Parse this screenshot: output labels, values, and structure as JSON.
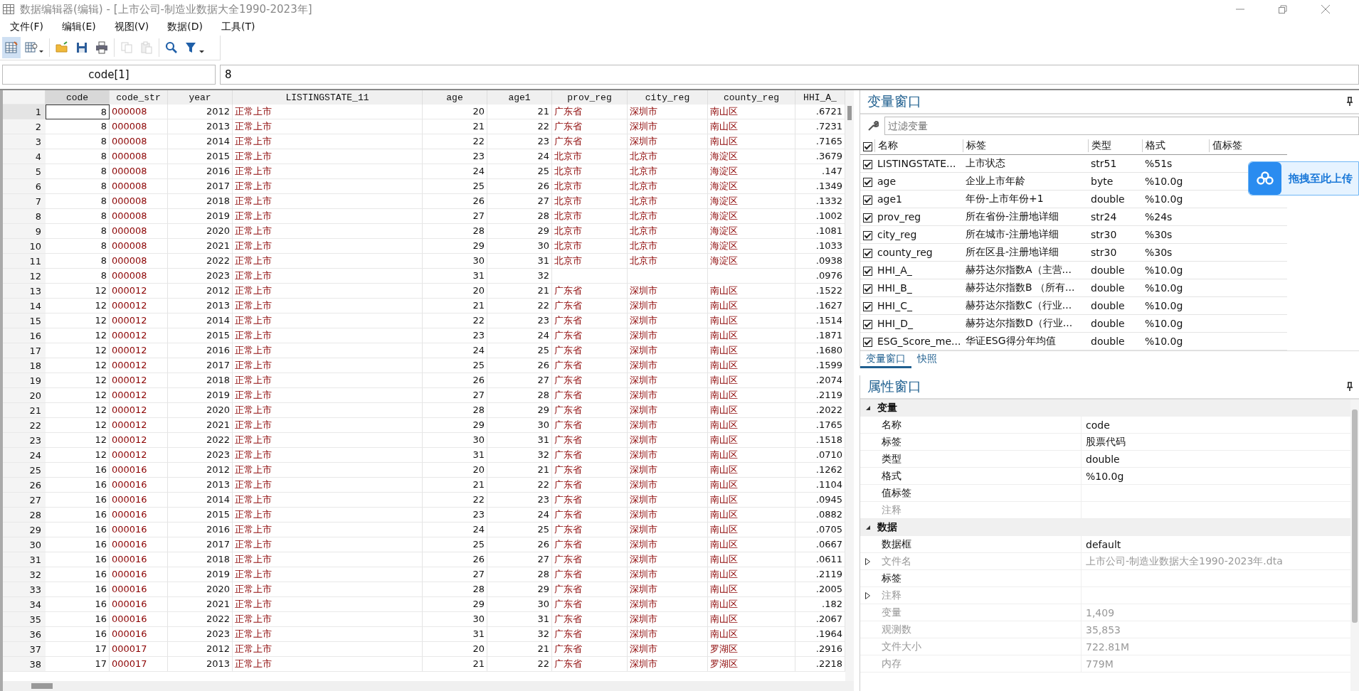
{
  "window": {
    "title": "数据编辑器(编辑) - [上市公司-制造业数据大全1990-2023年]"
  },
  "menu": [
    "文件(F)",
    "编辑(E)",
    "视图(V)",
    "数据(D)",
    "工具(T)"
  ],
  "toolbar": [
    {
      "kind": "grid-edit",
      "selected": true,
      "disabled": false
    },
    {
      "kind": "grid-browse",
      "selected": false,
      "disabled": false
    },
    {
      "kind": "folder",
      "selected": false,
      "disabled": false
    },
    {
      "kind": "save",
      "selected": false,
      "disabled": false
    },
    {
      "kind": "print",
      "selected": false,
      "disabled": false
    },
    {
      "kind": "copy",
      "selected": false,
      "disabled": true
    },
    {
      "kind": "paste",
      "selected": false,
      "disabled": true
    },
    {
      "kind": "search",
      "selected": false,
      "disabled": false
    },
    {
      "kind": "filter",
      "selected": false,
      "disabled": false
    }
  ],
  "cell_bar": {
    "name": "code[1]",
    "value": "8"
  },
  "table": {
    "columns": [
      {
        "label": "code",
        "kind": "num",
        "selected": true
      },
      {
        "label": "code_str",
        "kind": "str",
        "selected": false
      },
      {
        "label": "year",
        "kind": "num",
        "selected": false
      },
      {
        "label": "LISTINGSTATE_11",
        "kind": "str",
        "selected": false
      },
      {
        "label": "age",
        "kind": "num",
        "selected": false
      },
      {
        "label": "age1",
        "kind": "num",
        "selected": false
      },
      {
        "label": "prov_reg",
        "kind": "str",
        "selected": false
      },
      {
        "label": "city_reg",
        "kind": "str",
        "selected": false
      },
      {
        "label": "county_reg",
        "kind": "str",
        "selected": false
      },
      {
        "label": "HHI_A_",
        "kind": "num",
        "selected": false
      }
    ],
    "rows": [
      {
        "number": "1",
        "selected": true,
        "cells": [
          "8",
          "000008",
          "2012",
          "正常上市",
          "20",
          "21",
          "广东省",
          "深圳市",
          "南山区",
          ".6721"
        ]
      },
      {
        "number": "2",
        "selected": false,
        "cells": [
          "8",
          "000008",
          "2013",
          "正常上市",
          "21",
          "22",
          "广东省",
          "深圳市",
          "南山区",
          ".7231"
        ]
      },
      {
        "number": "3",
        "selected": false,
        "cells": [
          "8",
          "000008",
          "2014",
          "正常上市",
          "22",
          "23",
          "广东省",
          "深圳市",
          "南山区",
          ".7165"
        ]
      },
      {
        "number": "4",
        "selected": false,
        "cells": [
          "8",
          "000008",
          "2015",
          "正常上市",
          "23",
          "24",
          "北京市",
          "北京市",
          "海淀区",
          ".3679"
        ]
      },
      {
        "number": "5",
        "selected": false,
        "cells": [
          "8",
          "000008",
          "2016",
          "正常上市",
          "24",
          "25",
          "北京市",
          "北京市",
          "海淀区",
          ".147"
        ]
      },
      {
        "number": "6",
        "selected": false,
        "cells": [
          "8",
          "000008",
          "2017",
          "正常上市",
          "25",
          "26",
          "北京市",
          "北京市",
          "海淀区",
          ".1349"
        ]
      },
      {
        "number": "7",
        "selected": false,
        "cells": [
          "8",
          "000008",
          "2018",
          "正常上市",
          "26",
          "27",
          "北京市",
          "北京市",
          "海淀区",
          ".1332"
        ]
      },
      {
        "number": "8",
        "selected": false,
        "cells": [
          "8",
          "000008",
          "2019",
          "正常上市",
          "27",
          "28",
          "北京市",
          "北京市",
          "海淀区",
          ".1002"
        ]
      },
      {
        "number": "9",
        "selected": false,
        "cells": [
          "8",
          "000008",
          "2020",
          "正常上市",
          "28",
          "29",
          "北京市",
          "北京市",
          "海淀区",
          ".1081"
        ]
      },
      {
        "number": "10",
        "selected": false,
        "cells": [
          "8",
          "000008",
          "2021",
          "正常上市",
          "29",
          "30",
          "北京市",
          "北京市",
          "海淀区",
          ".1033"
        ]
      },
      {
        "number": "11",
        "selected": false,
        "cells": [
          "8",
          "000008",
          "2022",
          "正常上市",
          "30",
          "31",
          "北京市",
          "北京市",
          "海淀区",
          ".0938"
        ]
      },
      {
        "number": "12",
        "selected": false,
        "cells": [
          "8",
          "000008",
          "2023",
          "正常上市",
          "31",
          "32",
          null,
          null,
          null,
          ".0976"
        ]
      },
      {
        "number": "13",
        "selected": false,
        "cells": [
          "12",
          "000012",
          "2012",
          "正常上市",
          "20",
          "21",
          "广东省",
          "深圳市",
          "南山区",
          ".1522"
        ]
      },
      {
        "number": "14",
        "selected": false,
        "cells": [
          "12",
          "000012",
          "2013",
          "正常上市",
          "21",
          "22",
          "广东省",
          "深圳市",
          "南山区",
          ".1627"
        ]
      },
      {
        "number": "15",
        "selected": false,
        "cells": [
          "12",
          "000012",
          "2014",
          "正常上市",
          "22",
          "23",
          "广东省",
          "深圳市",
          "南山区",
          ".1514"
        ]
      },
      {
        "number": "16",
        "selected": false,
        "cells": [
          "12",
          "000012",
          "2015",
          "正常上市",
          "23",
          "24",
          "广东省",
          "深圳市",
          "南山区",
          ".1871"
        ]
      },
      {
        "number": "17",
        "selected": false,
        "cells": [
          "12",
          "000012",
          "2016",
          "正常上市",
          "24",
          "25",
          "广东省",
          "深圳市",
          "南山区",
          ".1680"
        ]
      },
      {
        "number": "18",
        "selected": false,
        "cells": [
          "12",
          "000012",
          "2017",
          "正常上市",
          "25",
          "26",
          "广东省",
          "深圳市",
          "南山区",
          ".1599"
        ]
      },
      {
        "number": "19",
        "selected": false,
        "cells": [
          "12",
          "000012",
          "2018",
          "正常上市",
          "26",
          "27",
          "广东省",
          "深圳市",
          "南山区",
          ".2074"
        ]
      },
      {
        "number": "20",
        "selected": false,
        "cells": [
          "12",
          "000012",
          "2019",
          "正常上市",
          "27",
          "28",
          "广东省",
          "深圳市",
          "南山区",
          ".2119"
        ]
      },
      {
        "number": "21",
        "selected": false,
        "cells": [
          "12",
          "000012",
          "2020",
          "正常上市",
          "28",
          "29",
          "广东省",
          "深圳市",
          "南山区",
          ".2022"
        ]
      },
      {
        "number": "22",
        "selected": false,
        "cells": [
          "12",
          "000012",
          "2021",
          "正常上市",
          "29",
          "30",
          "广东省",
          "深圳市",
          "南山区",
          ".1765"
        ]
      },
      {
        "number": "23",
        "selected": false,
        "cells": [
          "12",
          "000012",
          "2022",
          "正常上市",
          "30",
          "31",
          "广东省",
          "深圳市",
          "南山区",
          ".1518"
        ]
      },
      {
        "number": "24",
        "selected": false,
        "cells": [
          "12",
          "000012",
          "2023",
          "正常上市",
          "31",
          "32",
          "广东省",
          "深圳市",
          "南山区",
          ".0710"
        ]
      },
      {
        "number": "25",
        "selected": false,
        "cells": [
          "16",
          "000016",
          "2012",
          "正常上市",
          "20",
          "21",
          "广东省",
          "深圳市",
          "南山区",
          ".1262"
        ]
      },
      {
        "number": "26",
        "selected": false,
        "cells": [
          "16",
          "000016",
          "2013",
          "正常上市",
          "21",
          "22",
          "广东省",
          "深圳市",
          "南山区",
          ".1104"
        ]
      },
      {
        "number": "27",
        "selected": false,
        "cells": [
          "16",
          "000016",
          "2014",
          "正常上市",
          "22",
          "23",
          "广东省",
          "深圳市",
          "南山区",
          ".0945"
        ]
      },
      {
        "number": "28",
        "selected": false,
        "cells": [
          "16",
          "000016",
          "2015",
          "正常上市",
          "23",
          "24",
          "广东省",
          "深圳市",
          "南山区",
          ".0882"
        ]
      },
      {
        "number": "29",
        "selected": false,
        "cells": [
          "16",
          "000016",
          "2016",
          "正常上市",
          "24",
          "25",
          "广东省",
          "深圳市",
          "南山区",
          ".0705"
        ]
      },
      {
        "number": "30",
        "selected": false,
        "cells": [
          "16",
          "000016",
          "2017",
          "正常上市",
          "25",
          "26",
          "广东省",
          "深圳市",
          "南山区",
          ".0667"
        ]
      },
      {
        "number": "31",
        "selected": false,
        "cells": [
          "16",
          "000016",
          "2018",
          "正常上市",
          "26",
          "27",
          "广东省",
          "深圳市",
          "南山区",
          ".0611"
        ]
      },
      {
        "number": "32",
        "selected": false,
        "cells": [
          "16",
          "000016",
          "2019",
          "正常上市",
          "27",
          "28",
          "广东省",
          "深圳市",
          "南山区",
          ".2119"
        ]
      },
      {
        "number": "33",
        "selected": false,
        "cells": [
          "16",
          "000016",
          "2020",
          "正常上市",
          "28",
          "29",
          "广东省",
          "深圳市",
          "南山区",
          ".2005"
        ]
      },
      {
        "number": "34",
        "selected": false,
        "cells": [
          "16",
          "000016",
          "2021",
          "正常上市",
          "29",
          "30",
          "广东省",
          "深圳市",
          "南山区",
          ".182"
        ]
      },
      {
        "number": "35",
        "selected": false,
        "cells": [
          "16",
          "000016",
          "2022",
          "正常上市",
          "30",
          "31",
          "广东省",
          "深圳市",
          "南山区",
          ".2067"
        ]
      },
      {
        "number": "36",
        "selected": false,
        "cells": [
          "16",
          "000016",
          "2023",
          "正常上市",
          "31",
          "32",
          "广东省",
          "深圳市",
          "南山区",
          ".1964"
        ]
      },
      {
        "number": "37",
        "selected": false,
        "cells": [
          "17",
          "000017",
          "2012",
          "正常上市",
          "20",
          "21",
          "广东省",
          "深圳市",
          "罗湖区",
          ".2916"
        ]
      },
      {
        "number": "38",
        "selected": false,
        "cells": [
          "17",
          "000017",
          "2013",
          "正常上市",
          "21",
          "22",
          "广东省",
          "深圳市",
          "罗湖区",
          ".2218"
        ]
      }
    ]
  },
  "variables_window": {
    "title": "变量窗口",
    "filter": {
      "placeholder": "过滤变量"
    },
    "all_checked": true,
    "columns": [
      "名称",
      "标签",
      "类型",
      "格式",
      "值标签"
    ],
    "rows": [
      {
        "checked": true,
        "name": "LISTINGSTATE...",
        "label": "上市状态",
        "type": "str51",
        "format": "%51s"
      },
      {
        "checked": true,
        "name": "age",
        "label": "企业上市年龄",
        "type": "byte",
        "format": "%10.0g"
      },
      {
        "checked": true,
        "name": "age1",
        "label": "年份-上市年份+1",
        "type": "double",
        "format": "%10.0g"
      },
      {
        "checked": true,
        "name": "prov_reg",
        "label": "所在省份-注册地详细",
        "type": "str24",
        "format": "%24s"
      },
      {
        "checked": true,
        "name": "city_reg",
        "label": "所在城市-注册地详细",
        "type": "str30",
        "format": "%30s"
      },
      {
        "checked": true,
        "name": "county_reg",
        "label": "所在区县-注册地详细",
        "type": "str30",
        "format": "%30s"
      },
      {
        "checked": true,
        "name": "HHI_A_",
        "label": "赫芬达尔指数A（主营...",
        "type": "double",
        "format": "%10.0g"
      },
      {
        "checked": true,
        "name": "HHI_B_",
        "label": "赫芬达尔指数B （所有...",
        "type": "double",
        "format": "%10.0g"
      },
      {
        "checked": true,
        "name": "HHI_C_",
        "label": "赫芬达尔指数C（行业...",
        "type": "double",
        "format": "%10.0g"
      },
      {
        "checked": true,
        "name": "HHI_D_",
        "label": "赫芬达尔指数D（行业...",
        "type": "double",
        "format": "%10.0g"
      },
      {
        "checked": true,
        "name": "ESG_Score_me...",
        "label": "华证ESG得分年均值",
        "type": "double",
        "format": "%10.0g"
      }
    ],
    "tabs": [
      {
        "label": "变量窗口",
        "selected": true
      },
      {
        "label": "快照",
        "selected": false
      }
    ]
  },
  "upload_overlay": {
    "text": "拖拽至此上传"
  },
  "properties_window": {
    "title": "属性窗口",
    "groups": [
      {
        "title": "变量",
        "expanded": true,
        "rows": [
          {
            "name": "名称",
            "value": "code",
            "disabled": false,
            "expandable": false
          },
          {
            "name": "标签",
            "value": "股票代码",
            "disabled": false,
            "expandable": false
          },
          {
            "name": "类型",
            "value": "double",
            "disabled": false,
            "expandable": false
          },
          {
            "name": "格式",
            "value": "%10.0g",
            "disabled": false,
            "expandable": false
          },
          {
            "name": "值标签",
            "disabled": false,
            "expandable": false
          },
          {
            "name": "注释",
            "disabled": true,
            "expandable": false
          }
        ]
      },
      {
        "title": "数据",
        "expanded": true,
        "rows": [
          {
            "name": "数据框",
            "value": "default",
            "disabled": false,
            "expandable": false
          },
          {
            "name": "文件名",
            "value": "上市公司-制造业数据大全1990-2023年.dta",
            "disabled": true,
            "expandable": true
          },
          {
            "name": "标签",
            "disabled": false,
            "expandable": false
          },
          {
            "name": "注释",
            "disabled": true,
            "expandable": true
          },
          {
            "name": "变量",
            "value": "1,409",
            "disabled": true,
            "expandable": false
          },
          {
            "name": "观测数",
            "value": "35,853",
            "disabled": true,
            "expandable": false
          },
          {
            "name": "文件大小",
            "value": "722.81M",
            "disabled": true,
            "expandable": false
          },
          {
            "name": "内存",
            "value": "779M",
            "disabled": true,
            "expandable": false
          }
        ]
      }
    ]
  }
}
